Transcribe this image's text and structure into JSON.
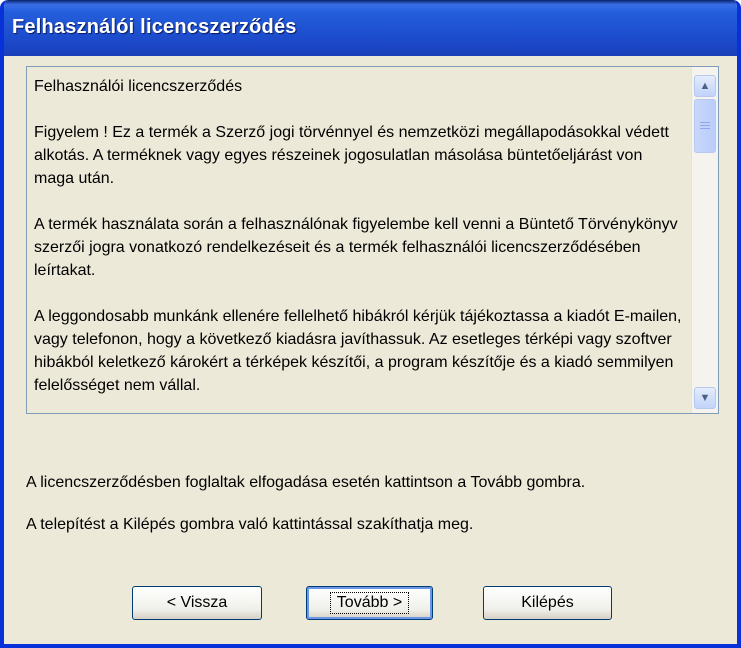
{
  "window": {
    "title": "Felhasználói licencszerződés"
  },
  "license": {
    "heading": "Felhasználói licencszerződés",
    "paragraphs": [
      "Figyelem ! Ez a termék a Szerző jogi törvénnyel és nemzetközi megállapodásokkal védett alkotás. A terméknek vagy egyes részeinek jogosulatlan másolása büntetőeljárást von maga után.",
      "A termék használata során a felhasználónak figyelembe kell venni a Büntető Törvénykönyv szerzői jogra vonatkozó rendelkezéseit és a termék felhasználói licencszerződésében leírtakat.",
      "A leggondosabb munkánk ellenére fellelhető hibákról kérjük tájékoztassa a kiadót E-mailen, vagy telefonon, hogy a következő kiadásra javíthassuk. Az esetleges térképi vagy szoftver hibákból keletkező károkért a térképek készítői, a program készítője és a kiadó semmilyen felelősséget nem vállal."
    ]
  },
  "scrollbar": {
    "up_icon": "scroll-up-arrow",
    "down_icon": "scroll-down-arrow"
  },
  "info": {
    "accept_text": "A licencszerződésben foglaltak elfogadása esetén kattintson a Tovább gombra.",
    "exit_text": "A telepítést a Kilépés gombra való kattintással szakíthatja meg."
  },
  "buttons": {
    "back": "< Vissza",
    "next": "Tovább >",
    "exit": "Kilépés"
  },
  "colors": {
    "titlebar": "#245edb",
    "face": "#ece9d8",
    "border": "#0831d9"
  }
}
